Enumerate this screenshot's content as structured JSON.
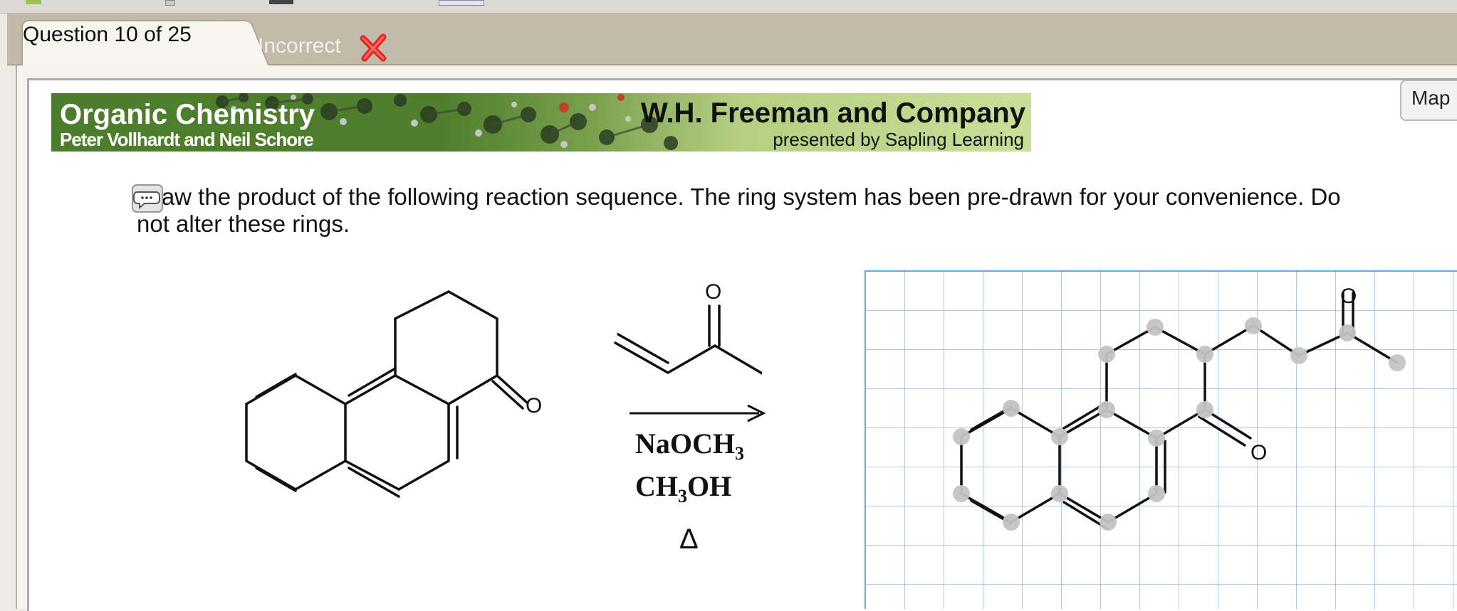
{
  "tabs": {
    "question_tab": "Question 10 of 25",
    "status": "Incorrect"
  },
  "banner": {
    "title": "Organic Chemistry",
    "authors": "Peter Vollhardt and Neil Schore",
    "publisher": "W.H. Freeman and Company",
    "presenter": "presented by Sapling Learning"
  },
  "map_button": "Map",
  "question": {
    "text": "Draw the product of the following reaction sequence. The ring system has been pre-drawn for your convenience. Do not alter these rings."
  },
  "reaction": {
    "reagent_1": "NaOCH",
    "reagent_1_sub": "3",
    "reagent_2a": "CH",
    "reagent_2_sub": "3",
    "reagent_2b": "OH",
    "condition": "Δ",
    "oxygen_label": "O"
  },
  "colors": {
    "incorrect_icon": "#e0282a",
    "grid_line": "#a9c9ea",
    "atom_marker": "#c4c4c4",
    "banner_green": "#4c7d2c"
  },
  "icons": [
    "incorrect-x-icon",
    "comment-icon",
    "reaction-arrow-icon"
  ]
}
